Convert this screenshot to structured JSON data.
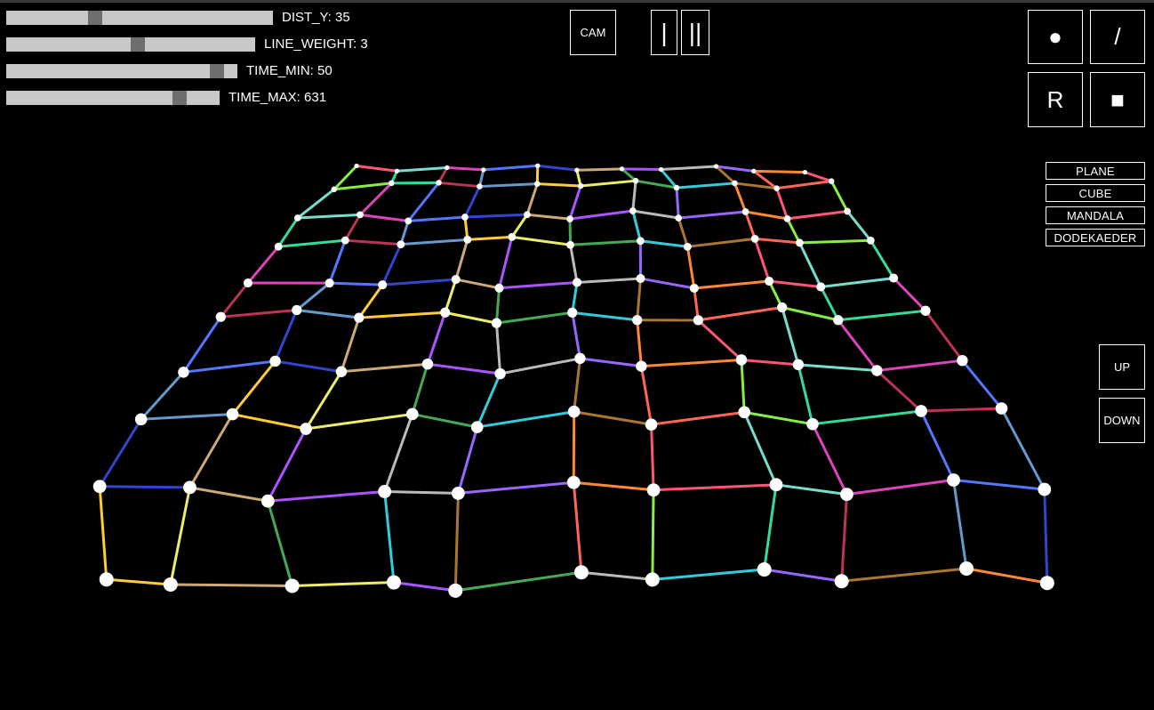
{
  "sliders": [
    {
      "label": "DIST_Y: 35",
      "value": 0.325
    },
    {
      "label": "LINE_WEIGHT: 3",
      "value": 0.53
    },
    {
      "label": "TIME_MIN: 50",
      "value": 0.94
    },
    {
      "label": "TIME_MAX: 631",
      "value": 0.835
    }
  ],
  "buttons": {
    "cam": "CAM",
    "single": "|",
    "double": "||",
    "dot": "●",
    "slash": "/",
    "reset": "R",
    "square": "■",
    "up": "UP",
    "down": "DOWN"
  },
  "presets": [
    "PLANE",
    "CUBE",
    "MANDALA",
    "DODEKAEDER"
  ],
  "colors": {
    "background": "#000000",
    "slider_track": "#c8c8c8",
    "slider_handle": "#6e6e6e",
    "node": "#ffffff",
    "button_border": "#ffffff"
  },
  "mesh": {
    "rows": 9,
    "cols": 10,
    "node_color": "#ffffff"
  }
}
